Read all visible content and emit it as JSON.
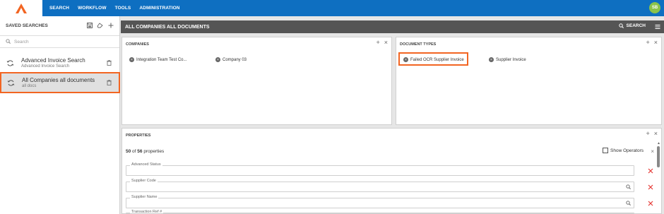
{
  "nav": {
    "items": [
      "SEARCH",
      "WORKFLOW",
      "TOOLS",
      "ADMINISTRATION"
    ],
    "avatar_initials": "SB"
  },
  "colors": {
    "nav_blue": "#0e6fc1",
    "highlight_orange": "#f26522",
    "header_gray": "#555555",
    "delete_red": "#e53935"
  },
  "sidebar": {
    "title": "SAVED SEARCHES",
    "search_placeholder": "Search",
    "items": [
      {
        "name": "Advanced Invoice Search",
        "sub": "Advanced Invoice Search",
        "icon": "saved-search-icon"
      },
      {
        "name": "All Companies all documents",
        "sub": "all docs",
        "icon": "saved-search-icon"
      }
    ]
  },
  "main": {
    "title": "ALL COMPANIES ALL DOCUMENTS",
    "search_label": "SEARCH"
  },
  "companies": {
    "title": "COMPANIES",
    "tags": [
      "Integration Team Test Co...",
      "Company 03"
    ]
  },
  "document_types": {
    "title": "DOCUMENT TYPES",
    "tags": [
      "Failed OCR Supplier Invoice",
      "Supplier Invoice"
    ]
  },
  "properties": {
    "title": "PROPERTIES",
    "count_shown": "50",
    "count_of": "of",
    "count_total": "56",
    "count_suffix": "properties",
    "show_operators_label": "Show Operators",
    "fields": [
      {
        "label": "Advanced Status",
        "has_search": false
      },
      {
        "label": "Supplier Code",
        "has_search": true
      },
      {
        "label": "Supplier Name",
        "has_search": true
      },
      {
        "label": "Transaction Ref #",
        "has_search": false
      }
    ]
  }
}
